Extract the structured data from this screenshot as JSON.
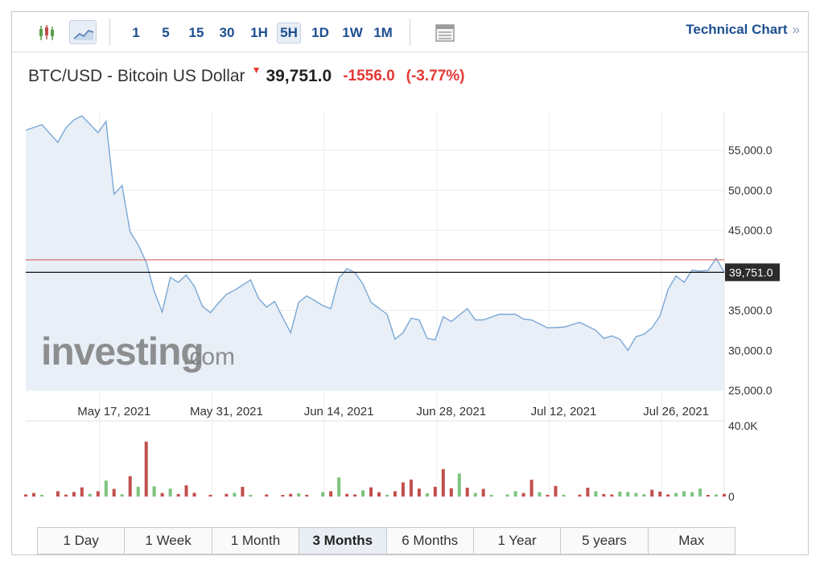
{
  "toolbar": {
    "intervals": [
      "1",
      "5",
      "15",
      "30",
      "1H",
      "5H",
      "1D",
      "1W",
      "1M"
    ],
    "active_interval": "5H",
    "technical_chart_label": "Technical Chart",
    "technical_chart_arrows": "»"
  },
  "header": {
    "instrument": "BTC/USD - Bitcoin US Dollar",
    "price": "39,751.0",
    "change": "-1556.0",
    "change_pct": "(-3.77%)",
    "down_color": "#e53935"
  },
  "watermark": {
    "brand": "investing",
    "suffix": ".com"
  },
  "ranges": {
    "items": [
      "1 Day",
      "1 Week",
      "1 Month",
      "3 Months",
      "6 Months",
      "1 Year",
      "5 years",
      "Max"
    ],
    "active": "3 Months"
  },
  "chart_data": {
    "type": "area",
    "x": [
      "2021-05-06",
      "2021-05-08",
      "2021-05-10",
      "2021-05-11",
      "2021-05-12",
      "2021-05-13",
      "2021-05-15",
      "2021-05-16",
      "2021-05-17",
      "2021-05-18",
      "2021-05-19",
      "2021-05-20",
      "2021-05-21",
      "2021-05-22",
      "2021-05-23",
      "2021-05-24",
      "2021-05-25",
      "2021-05-26",
      "2021-05-27",
      "2021-05-28",
      "2021-05-29",
      "2021-05-30",
      "2021-05-31",
      "2021-06-01",
      "2021-06-03",
      "2021-06-04",
      "2021-06-05",
      "2021-06-06",
      "2021-06-07",
      "2021-06-08",
      "2021-06-09",
      "2021-06-10",
      "2021-06-12",
      "2021-06-13",
      "2021-06-14",
      "2021-06-15",
      "2021-06-16",
      "2021-06-17",
      "2021-06-18",
      "2021-06-20",
      "2021-06-21",
      "2021-06-22",
      "2021-06-23",
      "2021-06-24",
      "2021-06-25",
      "2021-06-26",
      "2021-06-27",
      "2021-06-28",
      "2021-06-30",
      "2021-07-01",
      "2021-07-02",
      "2021-07-04",
      "2021-07-06",
      "2021-07-07",
      "2021-07-08",
      "2021-07-10",
      "2021-07-12",
      "2021-07-14",
      "2021-07-16",
      "2021-07-17",
      "2021-07-18",
      "2021-07-19",
      "2021-07-20",
      "2021-07-21",
      "2021-07-22",
      "2021-07-23",
      "2021-07-24",
      "2021-07-25",
      "2021-07-26",
      "2021-07-27",
      "2021-07-28",
      "2021-07-29",
      "2021-07-30",
      "2021-07-31",
      "2021-08-01"
    ],
    "series": [
      {
        "values": [
          57500,
          58200,
          56000,
          57800,
          58800,
          59300,
          57200,
          58600,
          49500,
          50600,
          44800,
          43200,
          41000,
          37400,
          34800,
          39100,
          38500,
          39400,
          38000,
          35500,
          34700,
          35900,
          37000,
          37500,
          38800,
          36500,
          35400,
          36100,
          34100,
          32200,
          36000,
          36800,
          35600,
          35200,
          39000,
          40200,
          39700,
          38300,
          36000,
          34500,
          31400,
          32200,
          34000,
          33800,
          31500,
          31300,
          34200,
          33600,
          35200,
          33800,
          33800,
          34500,
          34500,
          33900,
          33800,
          32800,
          32900,
          33500,
          32500,
          31500,
          31800,
          31400,
          30000,
          31700,
          32000,
          32800,
          34300,
          37600,
          39300,
          38500,
          40000,
          39900,
          40000,
          41500,
          39751
        ]
      }
    ],
    "volume": {
      "ylim": [
        0,
        40000
      ],
      "ytick_labels": [
        "40.0K",
        "0"
      ],
      "up_color": "#7cc47f",
      "down_color": "#c0504d",
      "bars": [
        {
          "x": "2021-05-06",
          "v": 1200,
          "dir": "down"
        },
        {
          "x": "2021-05-07",
          "v": 2000,
          "dir": "down"
        },
        {
          "x": "2021-05-08",
          "v": 1000,
          "dir": "up"
        },
        {
          "x": "2021-05-10",
          "v": 3000,
          "dir": "down"
        },
        {
          "x": "2021-05-11",
          "v": 1100,
          "dir": "down"
        },
        {
          "x": "2021-05-12",
          "v": 2600,
          "dir": "down"
        },
        {
          "x": "2021-05-13",
          "v": 5200,
          "dir": "down"
        },
        {
          "x": "2021-05-14",
          "v": 1500,
          "dir": "up"
        },
        {
          "x": "2021-05-15",
          "v": 3000,
          "dir": "down"
        },
        {
          "x": "2021-05-16",
          "v": 9000,
          "dir": "up"
        },
        {
          "x": "2021-05-17",
          "v": 4300,
          "dir": "down"
        },
        {
          "x": "2021-05-18",
          "v": 1300,
          "dir": "up"
        },
        {
          "x": "2021-05-19",
          "v": 11500,
          "dir": "down"
        },
        {
          "x": "2021-05-20",
          "v": 5500,
          "dir": "up"
        },
        {
          "x": "2021-05-21",
          "v": 31000,
          "dir": "down"
        },
        {
          "x": "2021-05-22",
          "v": 5800,
          "dir": "up"
        },
        {
          "x": "2021-05-23",
          "v": 2000,
          "dir": "down"
        },
        {
          "x": "2021-05-24",
          "v": 4500,
          "dir": "up"
        },
        {
          "x": "2021-05-25",
          "v": 1400,
          "dir": "down"
        },
        {
          "x": "2021-05-26",
          "v": 6300,
          "dir": "down"
        },
        {
          "x": "2021-05-27",
          "v": 2100,
          "dir": "down"
        },
        {
          "x": "2021-05-29",
          "v": 1000,
          "dir": "down"
        },
        {
          "x": "2021-05-31",
          "v": 1500,
          "dir": "down"
        },
        {
          "x": "2021-06-01",
          "v": 2100,
          "dir": "up"
        },
        {
          "x": "2021-06-02",
          "v": 5500,
          "dir": "down"
        },
        {
          "x": "2021-06-03",
          "v": 900,
          "dir": "up"
        },
        {
          "x": "2021-06-05",
          "v": 1200,
          "dir": "down"
        },
        {
          "x": "2021-06-07",
          "v": 900,
          "dir": "down"
        },
        {
          "x": "2021-06-08",
          "v": 1500,
          "dir": "down"
        },
        {
          "x": "2021-06-09",
          "v": 1800,
          "dir": "up"
        },
        {
          "x": "2021-06-10",
          "v": 1000,
          "dir": "down"
        },
        {
          "x": "2021-06-12",
          "v": 2500,
          "dir": "up"
        },
        {
          "x": "2021-06-13",
          "v": 3000,
          "dir": "down"
        },
        {
          "x": "2021-06-14",
          "v": 10800,
          "dir": "up"
        },
        {
          "x": "2021-06-15",
          "v": 1500,
          "dir": "down"
        },
        {
          "x": "2021-06-16",
          "v": 1200,
          "dir": "down"
        },
        {
          "x": "2021-06-17",
          "v": 3500,
          "dir": "up"
        },
        {
          "x": "2021-06-18",
          "v": 5200,
          "dir": "down"
        },
        {
          "x": "2021-06-19",
          "v": 2400,
          "dir": "down"
        },
        {
          "x": "2021-06-20",
          "v": 1000,
          "dir": "up"
        },
        {
          "x": "2021-06-21",
          "v": 3000,
          "dir": "down"
        },
        {
          "x": "2021-06-22",
          "v": 8000,
          "dir": "down"
        },
        {
          "x": "2021-06-23",
          "v": 9600,
          "dir": "down"
        },
        {
          "x": "2021-06-24",
          "v": 4500,
          "dir": "down"
        },
        {
          "x": "2021-06-25",
          "v": 1800,
          "dir": "up"
        },
        {
          "x": "2021-06-26",
          "v": 5500,
          "dir": "down"
        },
        {
          "x": "2021-06-27",
          "v": 15500,
          "dir": "down"
        },
        {
          "x": "2021-06-28",
          "v": 4700,
          "dir": "down"
        },
        {
          "x": "2021-06-29",
          "v": 13000,
          "dir": "up"
        },
        {
          "x": "2021-06-30",
          "v": 5000,
          "dir": "down"
        },
        {
          "x": "2021-07-01",
          "v": 2000,
          "dir": "up"
        },
        {
          "x": "2021-07-02",
          "v": 4300,
          "dir": "down"
        },
        {
          "x": "2021-07-03",
          "v": 1000,
          "dir": "up"
        },
        {
          "x": "2021-07-05",
          "v": 1200,
          "dir": "up"
        },
        {
          "x": "2021-07-06",
          "v": 3000,
          "dir": "up"
        },
        {
          "x": "2021-07-07",
          "v": 2000,
          "dir": "down"
        },
        {
          "x": "2021-07-08",
          "v": 9500,
          "dir": "down"
        },
        {
          "x": "2021-07-09",
          "v": 2500,
          "dir": "up"
        },
        {
          "x": "2021-07-10",
          "v": 1000,
          "dir": "down"
        },
        {
          "x": "2021-07-11",
          "v": 6000,
          "dir": "down"
        },
        {
          "x": "2021-07-12",
          "v": 1000,
          "dir": "up"
        },
        {
          "x": "2021-07-14",
          "v": 1100,
          "dir": "down"
        },
        {
          "x": "2021-07-15",
          "v": 5000,
          "dir": "down"
        },
        {
          "x": "2021-07-16",
          "v": 3000,
          "dir": "up"
        },
        {
          "x": "2021-07-17",
          "v": 1400,
          "dir": "down"
        },
        {
          "x": "2021-07-18",
          "v": 1200,
          "dir": "down"
        },
        {
          "x": "2021-07-19",
          "v": 2800,
          "dir": "up"
        },
        {
          "x": "2021-07-20",
          "v": 2600,
          "dir": "up"
        },
        {
          "x": "2021-07-21",
          "v": 2000,
          "dir": "up"
        },
        {
          "x": "2021-07-22",
          "v": 1300,
          "dir": "up"
        },
        {
          "x": "2021-07-23",
          "v": 3800,
          "dir": "down"
        },
        {
          "x": "2021-07-24",
          "v": 2800,
          "dir": "down"
        },
        {
          "x": "2021-07-25",
          "v": 1200,
          "dir": "down"
        },
        {
          "x": "2021-07-26",
          "v": 2000,
          "dir": "up"
        },
        {
          "x": "2021-07-27",
          "v": 3000,
          "dir": "up"
        },
        {
          "x": "2021-07-28",
          "v": 2500,
          "dir": "up"
        },
        {
          "x": "2021-07-29",
          "v": 4500,
          "dir": "up"
        },
        {
          "x": "2021-07-30",
          "v": 900,
          "dir": "down"
        },
        {
          "x": "2021-07-31",
          "v": 1200,
          "dir": "up"
        },
        {
          "x": "2021-08-01",
          "v": 1500,
          "dir": "down"
        }
      ]
    },
    "xlim": [
      "2021-05-06",
      "2021-08-01"
    ],
    "ylim": [
      25000,
      59800
    ],
    "x_tick_labels": [
      {
        "x": "2021-05-17",
        "label": "May 17, 2021"
      },
      {
        "x": "2021-05-31",
        "label": "May 31, 2021"
      },
      {
        "x": "2021-06-14",
        "label": "Jun 14, 2021"
      },
      {
        "x": "2021-06-28",
        "label": "Jun 28, 2021"
      },
      {
        "x": "2021-07-12",
        "label": "Jul 12, 2021"
      },
      {
        "x": "2021-07-26",
        "label": "Jul 26, 2021"
      }
    ],
    "y_tick_labels": [
      {
        "y": 55000,
        "label": "55,000.0"
      },
      {
        "y": 50000,
        "label": "50,000.0"
      },
      {
        "y": 45000,
        "label": "45,000.0"
      },
      {
        "y": 35000,
        "label": "35,000.0"
      },
      {
        "y": 30000,
        "label": "30,000.0"
      },
      {
        "y": 25000,
        "label": "25,000.0"
      }
    ],
    "current_price": {
      "y": 39751,
      "label": "39,751.0"
    },
    "previous_close": 41307,
    "line_color": "#7aa7d6",
    "fill_color": "#e8eff7",
    "grid": true
  }
}
